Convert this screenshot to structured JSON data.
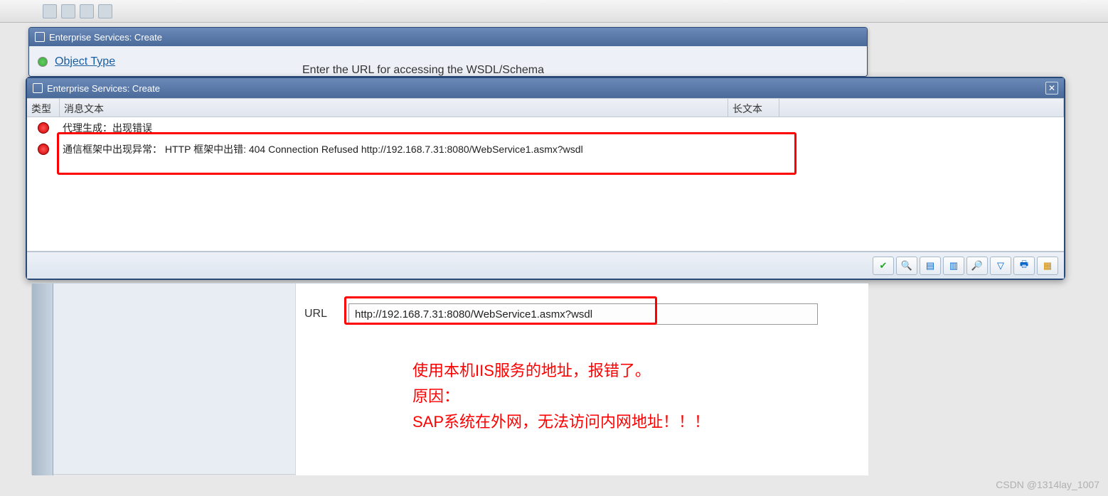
{
  "dialog_back": {
    "title": "Enterprise Services: Create",
    "object_type_label": "Object Type",
    "prompt": "Enter the URL for accessing the WSDL/Schema"
  },
  "dialog_front": {
    "title": "Enterprise Services: Create",
    "columns": {
      "type": "类型",
      "text": "消息文本",
      "long": "长文本"
    },
    "messages": [
      {
        "status": "error",
        "text": "代理生成：出现错误"
      },
      {
        "status": "error",
        "text": "通信框架中出现异常： HTTP 框架中出错: 404  Connection Refused http://192.168.7.31:8080/WebService1.asmx?wsdl"
      }
    ],
    "toolbar": {
      "check": "✔",
      "search": "🔍",
      "sort_asc": "▤",
      "sort_desc": "▥",
      "find": "🔎",
      "filter": "▽",
      "print": "🖶",
      "layout": "▦"
    }
  },
  "url_section": {
    "label": "URL",
    "value": "http://192.168.7.31:8080/WebService1.asmx?wsdl"
  },
  "annotation": {
    "line1": "使用本机IIS服务的地址，报错了。",
    "line2": "原因：",
    "line3": "SAP系统在外网，无法访问内网地址！！！"
  },
  "watermark": "CSDN @1314lay_1007"
}
